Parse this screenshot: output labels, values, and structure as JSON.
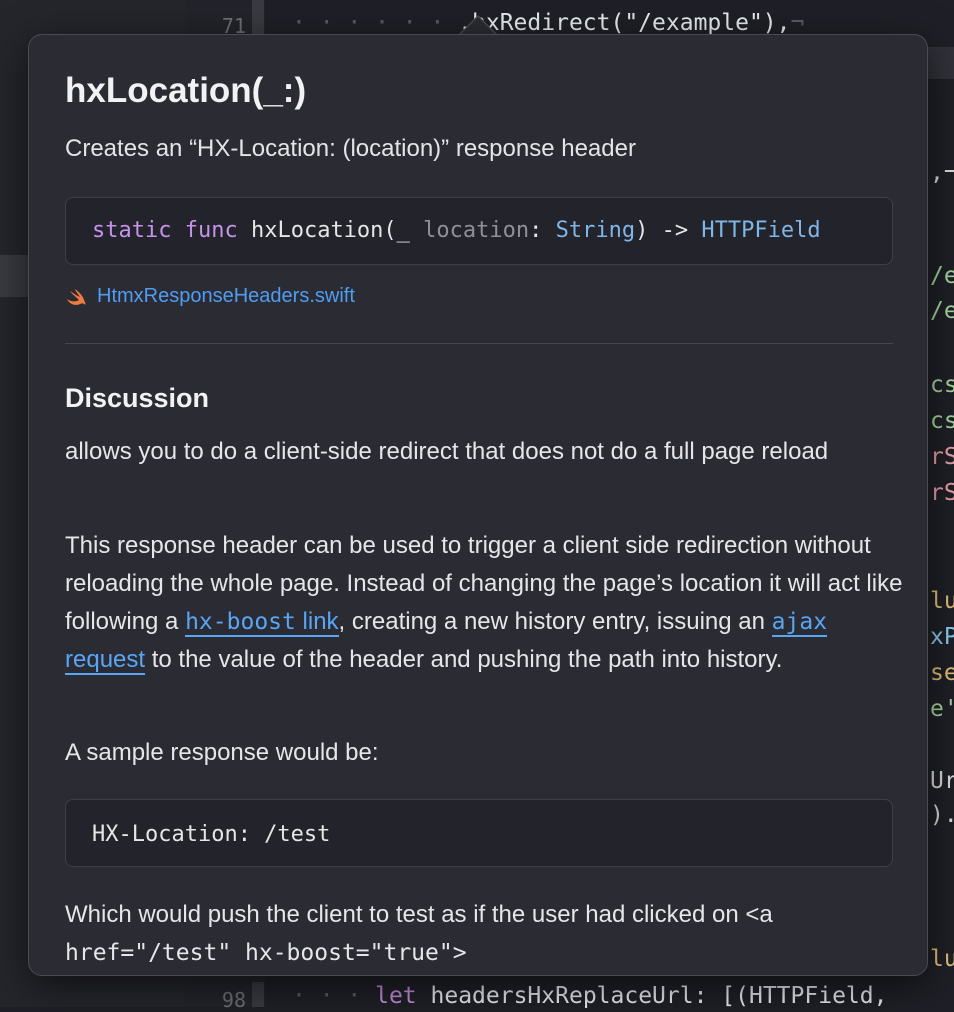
{
  "editor": {
    "top_line": {
      "number": "71",
      "indent": "· · · · · · ",
      "text": ".hxRedirect(\"/example\"),",
      "eol": "¬"
    },
    "bottom_line": {
      "number": "98",
      "indent": "· · · ",
      "keyword": "let",
      "text": "headersHxReplaceUrl: [(HTTPField,"
    },
    "right_fragments": [
      ",¬",
      "/e",
      "/e",
      "cs",
      "cs",
      "rS",
      "rS",
      "lu",
      "xP",
      "se",
      "e'",
      "Ur",
      ").",
      "lu"
    ]
  },
  "popover": {
    "title": "hxLocation(_:)",
    "summary": "Creates an “HX-Location: (location)” response header",
    "declaration": {
      "static": "static",
      "func": "func",
      "name": "hxLocation(_",
      "param": "location",
      "colon": ":",
      "param_type": "String",
      "arrow": ") ->",
      "return_type": "HTTPField"
    },
    "file_link": {
      "icon": "swift-icon",
      "label": "HtmxResponseHeaders.swift"
    },
    "discussion_heading": "Discussion",
    "para1": "allows you to do a client-side redirect that does not do a full page reload",
    "para2": {
      "part1": "This response header can be used to trigger a client side redirection without reloading the whole page. Instead of changing the page’s location it will act like following a ",
      "link1_code": "hx-boost",
      "link1_text": " link",
      "part2": ", creating a new history entry, issuing an ",
      "link2_code": "ajax",
      "link2_text": " request",
      "part3": " to the value of the header and pushing the path into history."
    },
    "para3": "A sample response would be:",
    "sample_code": "HX-Location: /test",
    "para4": {
      "part1": "Which would push the client to test as if the user had clicked on <a",
      "code": "href=\"/test\" hx-boost=\"true\">"
    }
  },
  "colors": {
    "link": "#58a6f5",
    "keyword": "#c792ea",
    "type": "#7fb6e8"
  }
}
